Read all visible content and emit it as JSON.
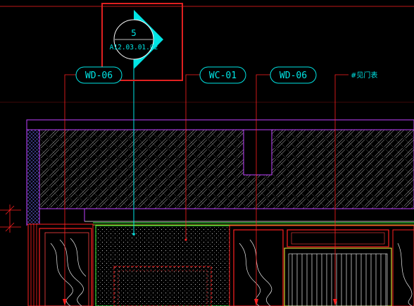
{
  "colors": {
    "background": "#000000",
    "cyan": "#00e5e5",
    "red": "#ff2020",
    "magenta": "#c040ff",
    "yellow": "#ffff40",
    "green": "#40ff40",
    "white": "#ffffff",
    "highlight": "#e02020"
  },
  "section_symbol": {
    "number": "5",
    "reference": "A12.03.01.02"
  },
  "material_tags": [
    {
      "id": "tag1",
      "label": "WD-06"
    },
    {
      "id": "tag2",
      "label": "WC-01"
    },
    {
      "id": "tag3",
      "label": "WD-06"
    }
  ],
  "note": {
    "label": "#见门表"
  }
}
